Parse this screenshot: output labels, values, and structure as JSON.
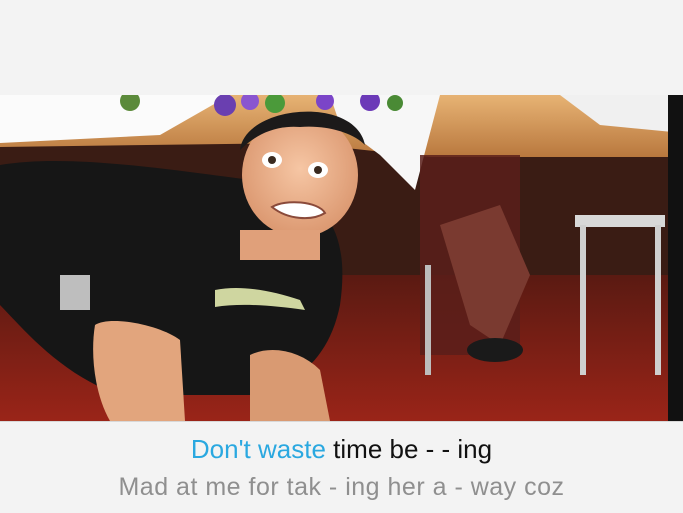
{
  "lyrics": {
    "current_line": {
      "sung": "Don't waste",
      "unsung": "time be - - ing"
    },
    "next_line": "Mad at me for tak - ing her a - way coz"
  },
  "colors": {
    "sung_highlight": "#2aa8e0",
    "unsung_text": "#111111",
    "next_line_text": "#8f8f8f",
    "panel_background": "#f3f3f3"
  }
}
